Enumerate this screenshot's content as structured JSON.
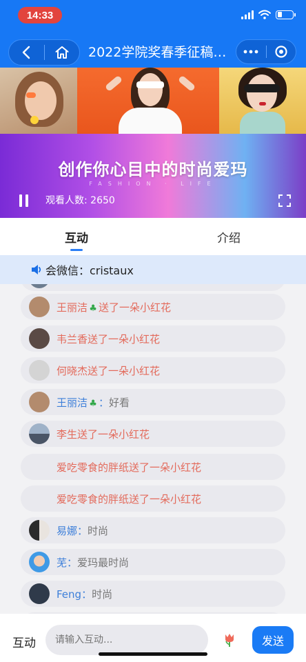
{
  "status_bar": {
    "time": "14:33",
    "battery_level": 0.3
  },
  "nav": {
    "title": "2022学院奖春季征稿…",
    "back_icon": "chevron-left-icon",
    "home_icon": "home-icon",
    "more_icon": "more-dots-icon",
    "close_icon": "target-icon"
  },
  "video": {
    "banner_title": "创作你心目中的时尚爱玛",
    "banner_sub": "FASHION · LIFE",
    "viewers_label": "观看人数: 2650"
  },
  "tabs": {
    "active": "互动",
    "intro": "介绍"
  },
  "notice": {
    "text": "会微信：cristaux"
  },
  "messages": [
    {
      "type": "gift",
      "text": "王丽洁",
      "emoji": "🍀",
      "suffix": "送了一朵小红花",
      "avatar_color": "#b38b6d"
    },
    {
      "type": "gift",
      "text": "韦兰香送了一朵小红花",
      "avatar_color": "#5a4a45"
    },
    {
      "type": "gift",
      "text": "何晓杰送了一朵小红花",
      "avatar_color": "#cfcfcf"
    },
    {
      "type": "chat",
      "name": "王丽洁",
      "emoji": "🍀",
      "colon": "：",
      "content": "好看",
      "avatar_color": "#b38b6d"
    },
    {
      "type": "gift",
      "text": "李生送了一朵小红花",
      "avatar_color": "#6f7f95"
    },
    {
      "type": "gift_noav",
      "text": "爱吃零食的胖纸送了一朵小红花"
    },
    {
      "type": "gift_noav",
      "text": "爱吃零食的胖纸送了一朵小红花"
    },
    {
      "type": "chat",
      "name": "易娜",
      "colon": "：",
      "content": "时尚",
      "avatar_color": "#3a3a3a"
    },
    {
      "type": "chat",
      "name": "芜",
      "colon": "：",
      "content": "爱玛最时尚",
      "avatar_color": "#3f9ae6"
    },
    {
      "type": "chat",
      "name": "Feng",
      "colon": "：",
      "content": "时尚",
      "avatar_color": "#2f3a4a"
    }
  ],
  "bottom": {
    "label": "互动",
    "input_placeholder": "请输入互动...",
    "send_label": "发送",
    "flower_icon": "tulip-icon"
  }
}
